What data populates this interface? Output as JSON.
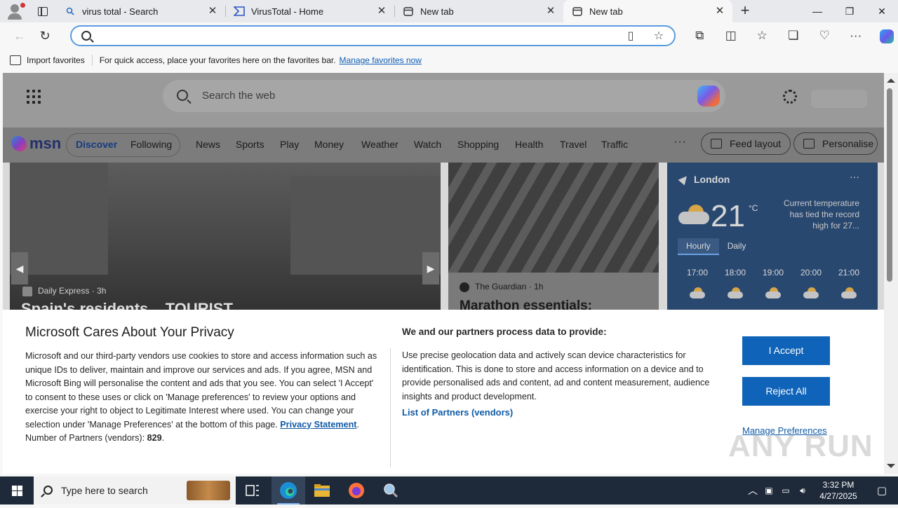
{
  "browser": {
    "tabs": [
      {
        "title": "virus total - Search",
        "active": false,
        "icon": "search-icon"
      },
      {
        "title": "VirusTotal - Home",
        "active": false,
        "icon": "virustotal-icon"
      },
      {
        "title": "New tab",
        "active": false,
        "icon": "newtab-icon"
      },
      {
        "title": "New tab",
        "active": true,
        "icon": "newtab-icon"
      }
    ],
    "new_tab_label": "+",
    "address": {
      "value": "",
      "placeholder": ""
    }
  },
  "favorites_bar": {
    "import_label": "Import favorites",
    "hint": "For quick access, place your favorites here on the favorites bar.",
    "manage_link": "Manage favorites now"
  },
  "msn": {
    "search_placeholder": "Search the web",
    "logo": "msn",
    "nav": [
      "Discover",
      "Following",
      "News",
      "Sports",
      "Play",
      "Money",
      "Weather",
      "Watch",
      "Shopping",
      "Health",
      "Travel",
      "Traffic"
    ],
    "more": "···",
    "feed_layout": "Feed layout",
    "personalise": "Personalise",
    "hero": {
      "source": "Daily Express",
      "age": "3h",
      "headline": "Spain's residents... TOURIST..."
    },
    "mid_card": {
      "source": "The Guardian",
      "age": "1h",
      "headline": "Marathon essentials:"
    },
    "weather": {
      "city": "London",
      "temp": "21",
      "unit": "°C",
      "note": "Current temperature has tied the record high for 27...",
      "tabs": [
        "Hourly",
        "Daily"
      ],
      "hours": [
        "17:00",
        "18:00",
        "19:00",
        "20:00",
        "21:00"
      ]
    }
  },
  "privacy": {
    "title": "Microsoft Cares About Your Privacy",
    "body_1": "Microsoft and our third-party vendors use cookies to store and access information such as unique IDs to deliver, maintain and improve our services and ads. If you agree, MSN and Microsoft Bing will personalise the content and ads that you see. You can select 'I Accept' to consent to these uses or click on 'Manage preferences' to review your options and exercise your right to object to Legitimate Interest where used.  You can change your selection under 'Manage Preferences' at the bottom of this page.",
    "privacy_link": "Privacy Statement",
    "partners_label": "Number of Partners (vendors):",
    "partners_count": "829",
    "purposes_title": "We and our partners process data to provide:",
    "body_2": "Use precise geolocation data and actively scan device characteristics for identification. This is done to store and access information on a device and to provide personalised ads and content, ad and content measurement, audience insights and product development.",
    "vendors_link": "List of Partners (vendors)",
    "accept": "I Accept",
    "reject": "Reject All",
    "manage": "Manage Preferences"
  },
  "watermark": "ANY RUN",
  "taskbar": {
    "search_placeholder": "Type here to search",
    "time": "3:32 PM",
    "date": "4/27/2025"
  }
}
